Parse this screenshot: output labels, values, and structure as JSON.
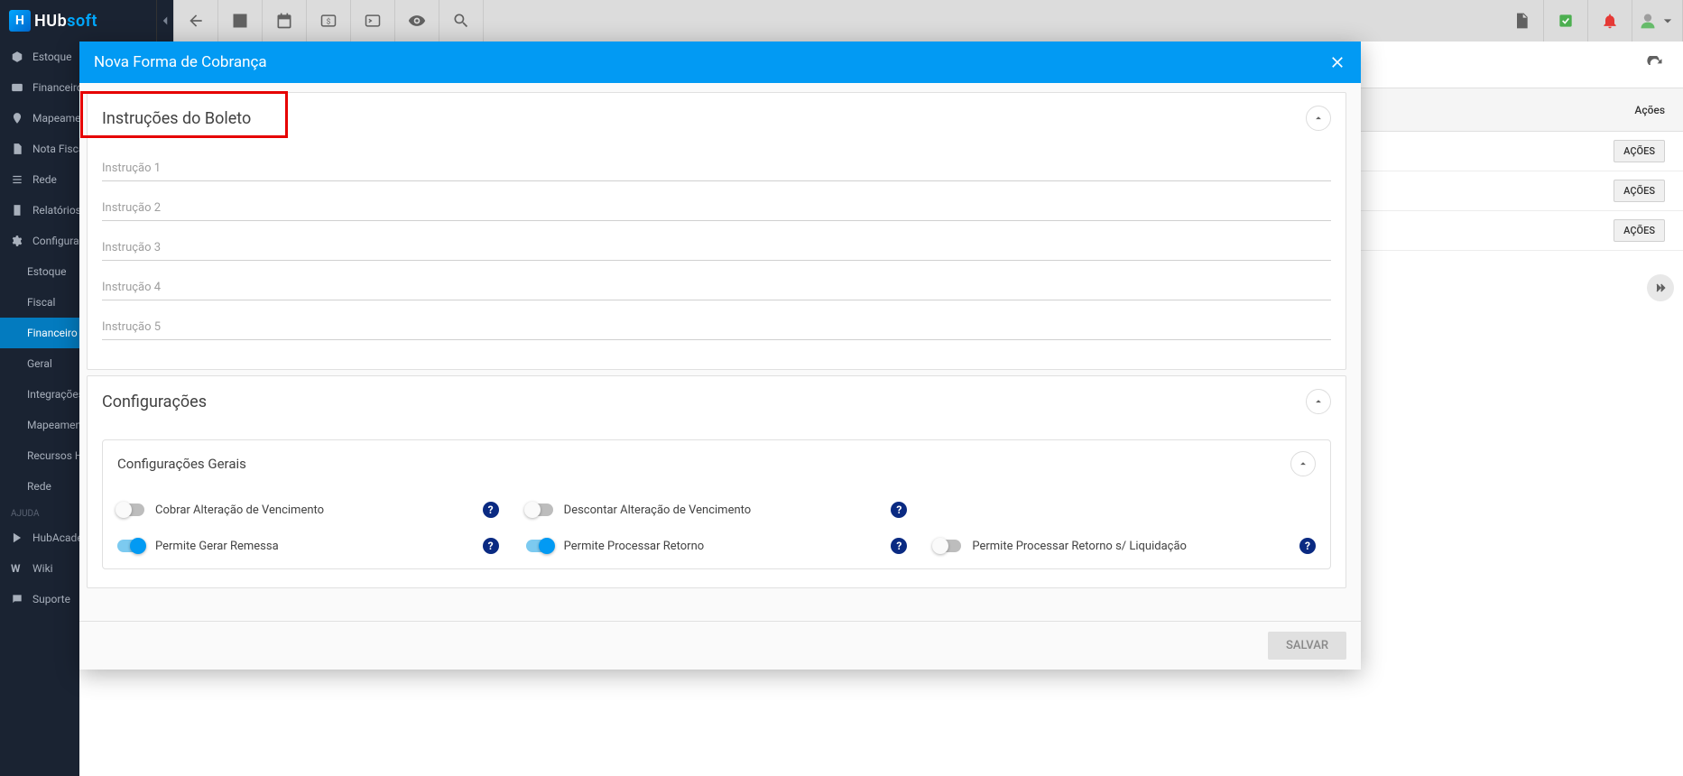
{
  "app": {
    "logo_text_left": "HUb",
    "logo_text_right": "soft"
  },
  "toolbar": {
    "icons": [
      "back",
      "account",
      "calendar",
      "money",
      "terminal",
      "eye",
      "search"
    ],
    "right_icons": [
      "pdf",
      "check",
      "bell",
      "avatar"
    ]
  },
  "sidebar": {
    "items": [
      {
        "icon": "cube",
        "label": "Estoque"
      },
      {
        "icon": "card",
        "label": "Financeiro"
      },
      {
        "icon": "marker",
        "label": "Mapeamento"
      },
      {
        "icon": "doc",
        "label": "Nota Fiscal"
      },
      {
        "icon": "network",
        "label": "Rede"
      },
      {
        "icon": "report",
        "label": "Relatórios"
      },
      {
        "icon": "gear",
        "label": "Configuraçõ"
      }
    ],
    "sub_items": [
      {
        "label": "Estoque"
      },
      {
        "label": "Fiscal"
      },
      {
        "label": "Financeiro",
        "active": true
      },
      {
        "label": "Geral"
      },
      {
        "label": "Integrações"
      },
      {
        "label": "Mapeamento"
      },
      {
        "label": "Recursos Hu"
      },
      {
        "label": "Rede"
      }
    ],
    "help_section": "AJUDA",
    "help_items": [
      {
        "icon": "play",
        "label": "HubAcademy"
      },
      {
        "icon": "w",
        "label": "Wiki"
      },
      {
        "icon": "chat",
        "label": "Suporte"
      }
    ]
  },
  "background": {
    "header_actions": "Ações",
    "row_button_label": "AÇÕES",
    "rows": 3
  },
  "modal": {
    "title": "Nova Forma de Cobrança",
    "save_label": "SALVAR",
    "sections": {
      "instructions": {
        "title": "Instruções do Boleto",
        "fields": [
          {
            "placeholder": "Instrução 1"
          },
          {
            "placeholder": "Instrução 2"
          },
          {
            "placeholder": "Instrução 3"
          },
          {
            "placeholder": "Instrução 4"
          },
          {
            "placeholder": "Instrução 5"
          }
        ]
      },
      "configurations": {
        "title": "Configurações",
        "general": {
          "title": "Configurações Gerais",
          "row1": {
            "a": {
              "label": "Cobrar Alteração de Vencimento",
              "on": false,
              "help": true
            },
            "b": {
              "label": "Descontar Alteração de Vencimento",
              "on": false,
              "help": true
            }
          },
          "row2": {
            "a": {
              "label": "Permite Gerar Remessa",
              "on": true,
              "help": true
            },
            "b": {
              "label": "Permite Processar Retorno",
              "on": true,
              "help": true
            },
            "c": {
              "label": "Permite Processar Retorno s/ Liquidação",
              "on": false,
              "help": true
            }
          }
        }
      }
    }
  },
  "colors": {
    "primary": "#029af3",
    "dark_help": "#0a2a82",
    "highlight_border": "#e60000"
  }
}
